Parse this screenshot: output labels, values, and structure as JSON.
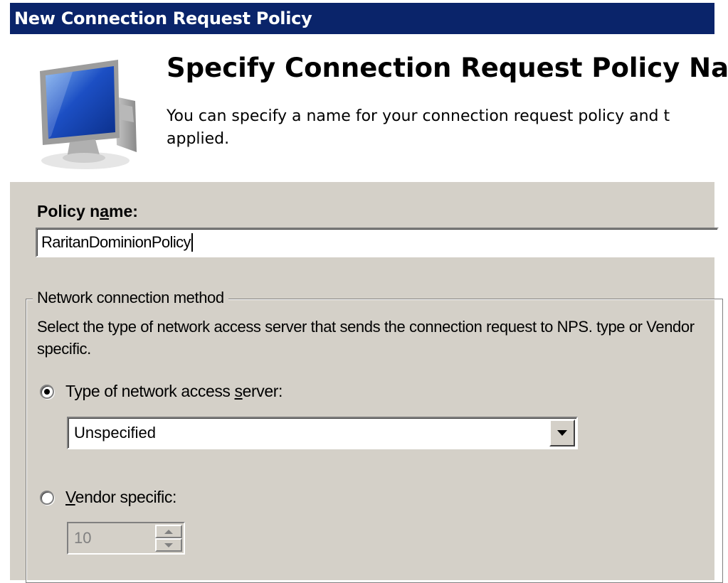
{
  "window": {
    "title": "New Connection Request Policy"
  },
  "header": {
    "heading": "Specify Connection Request Policy Nam",
    "description": "You can specify a name for your connection request policy and t applied.",
    "icon": "monitor-icon"
  },
  "policy_name": {
    "label_pre": "Policy n",
    "label_mnemonic": "a",
    "label_post": "me:",
    "value": "RaritanDominionPolicy"
  },
  "network_connection_method": {
    "legend": "Network connection method",
    "description": "Select the type of network access server that sends the connection request to NPS. type or Vendor specific.",
    "type_option": {
      "label_pre": "Type of network access ",
      "label_mnemonic": "s",
      "label_post": "erver:",
      "selected": true,
      "dropdown_value": "Unspecified"
    },
    "vendor_option": {
      "label_mnemonic": "V",
      "label_post": "endor specific:",
      "selected": false,
      "spinner_value": "10"
    }
  },
  "colors": {
    "titlebar": "#0a246a",
    "dialog_bg": "#d4d0c8",
    "header_bg": "#ffffff"
  }
}
